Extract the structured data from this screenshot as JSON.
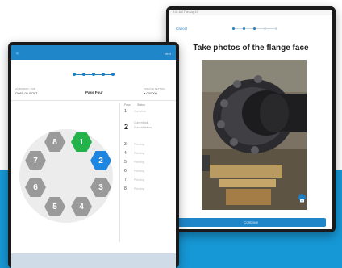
{
  "colors": {
    "accent_blue": "#1f86c9",
    "background_band": "#1698d6",
    "bolt_green": "#24b24b",
    "bolt_blue": "#1f86e0",
    "bolt_gray": "#9a9a9a"
  },
  "right_screen": {
    "status": "9:41 AM  Tue Aug 10",
    "cancel_label": "Cancel",
    "title": "Take photos of the flange face",
    "continue_label": "Continue",
    "camera_icon": "camera-icon"
  },
  "left_screen": {
    "nav_back": "<",
    "nav_action": "Next",
    "info": {
      "left_caption": "EQUIPMENT / JOB",
      "left_value": "02065-06-BOLT",
      "middle_value": "Pass Four",
      "right_caption": "TORQUE SETTING",
      "right_value": "● 000000"
    },
    "table_headers": [
      "Pass",
      "Status"
    ],
    "current_status": "Current status",
    "bolts": [
      {
        "label": "8",
        "state": "gray"
      },
      {
        "label": "1",
        "state": "green"
      },
      {
        "label": "2",
        "state": "blue"
      },
      {
        "label": "3",
        "state": "gray"
      },
      {
        "label": "4",
        "state": "gray"
      },
      {
        "label": "5",
        "state": "gray"
      },
      {
        "label": "6",
        "state": "gray"
      },
      {
        "label": "7",
        "state": "gray"
      }
    ],
    "rows": [
      {
        "num": "1",
        "status": "Complete"
      },
      {
        "num": "2",
        "status": "Current bolt"
      },
      {
        "num": "3",
        "status": "Pending"
      },
      {
        "num": "4",
        "status": "Pending"
      },
      {
        "num": "5",
        "status": "Pending"
      },
      {
        "num": "6",
        "status": "Pending"
      },
      {
        "num": "7",
        "status": "Pending"
      },
      {
        "num": "8",
        "status": "Pending"
      }
    ]
  }
}
